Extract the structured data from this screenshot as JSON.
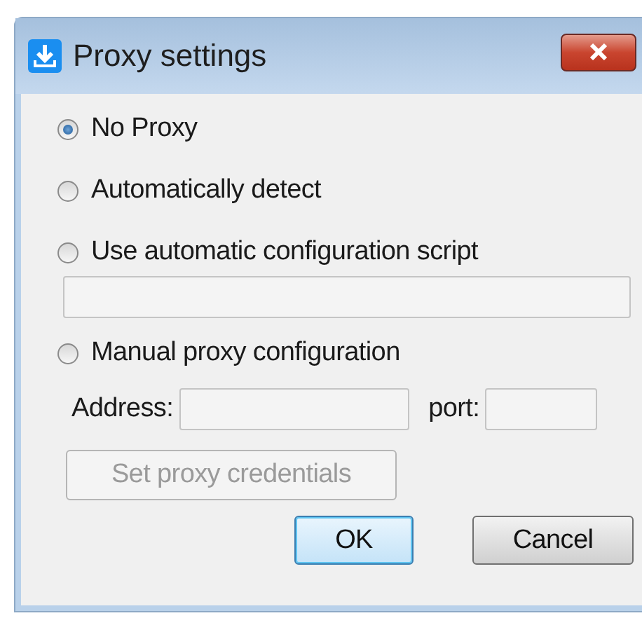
{
  "window": {
    "title": "Proxy settings"
  },
  "options": [
    {
      "label": "No Proxy",
      "selected": true
    },
    {
      "label": "Automatically detect",
      "selected": false
    },
    {
      "label": "Use automatic configuration script",
      "selected": false,
      "field": {
        "disabled": true
      }
    },
    {
      "label": "Manual proxy configuration",
      "selected": false,
      "fields": [
        {
          "label": "Address:",
          "disabled": true
        },
        {
          "label": "port:",
          "disabled": true
        }
      ]
    }
  ],
  "credentials_button": {
    "label": "Set proxy credentials",
    "disabled": true
  },
  "buttons": [
    {
      "label": "OK",
      "default": true
    },
    {
      "label": "Cancel",
      "default": false
    }
  ]
}
